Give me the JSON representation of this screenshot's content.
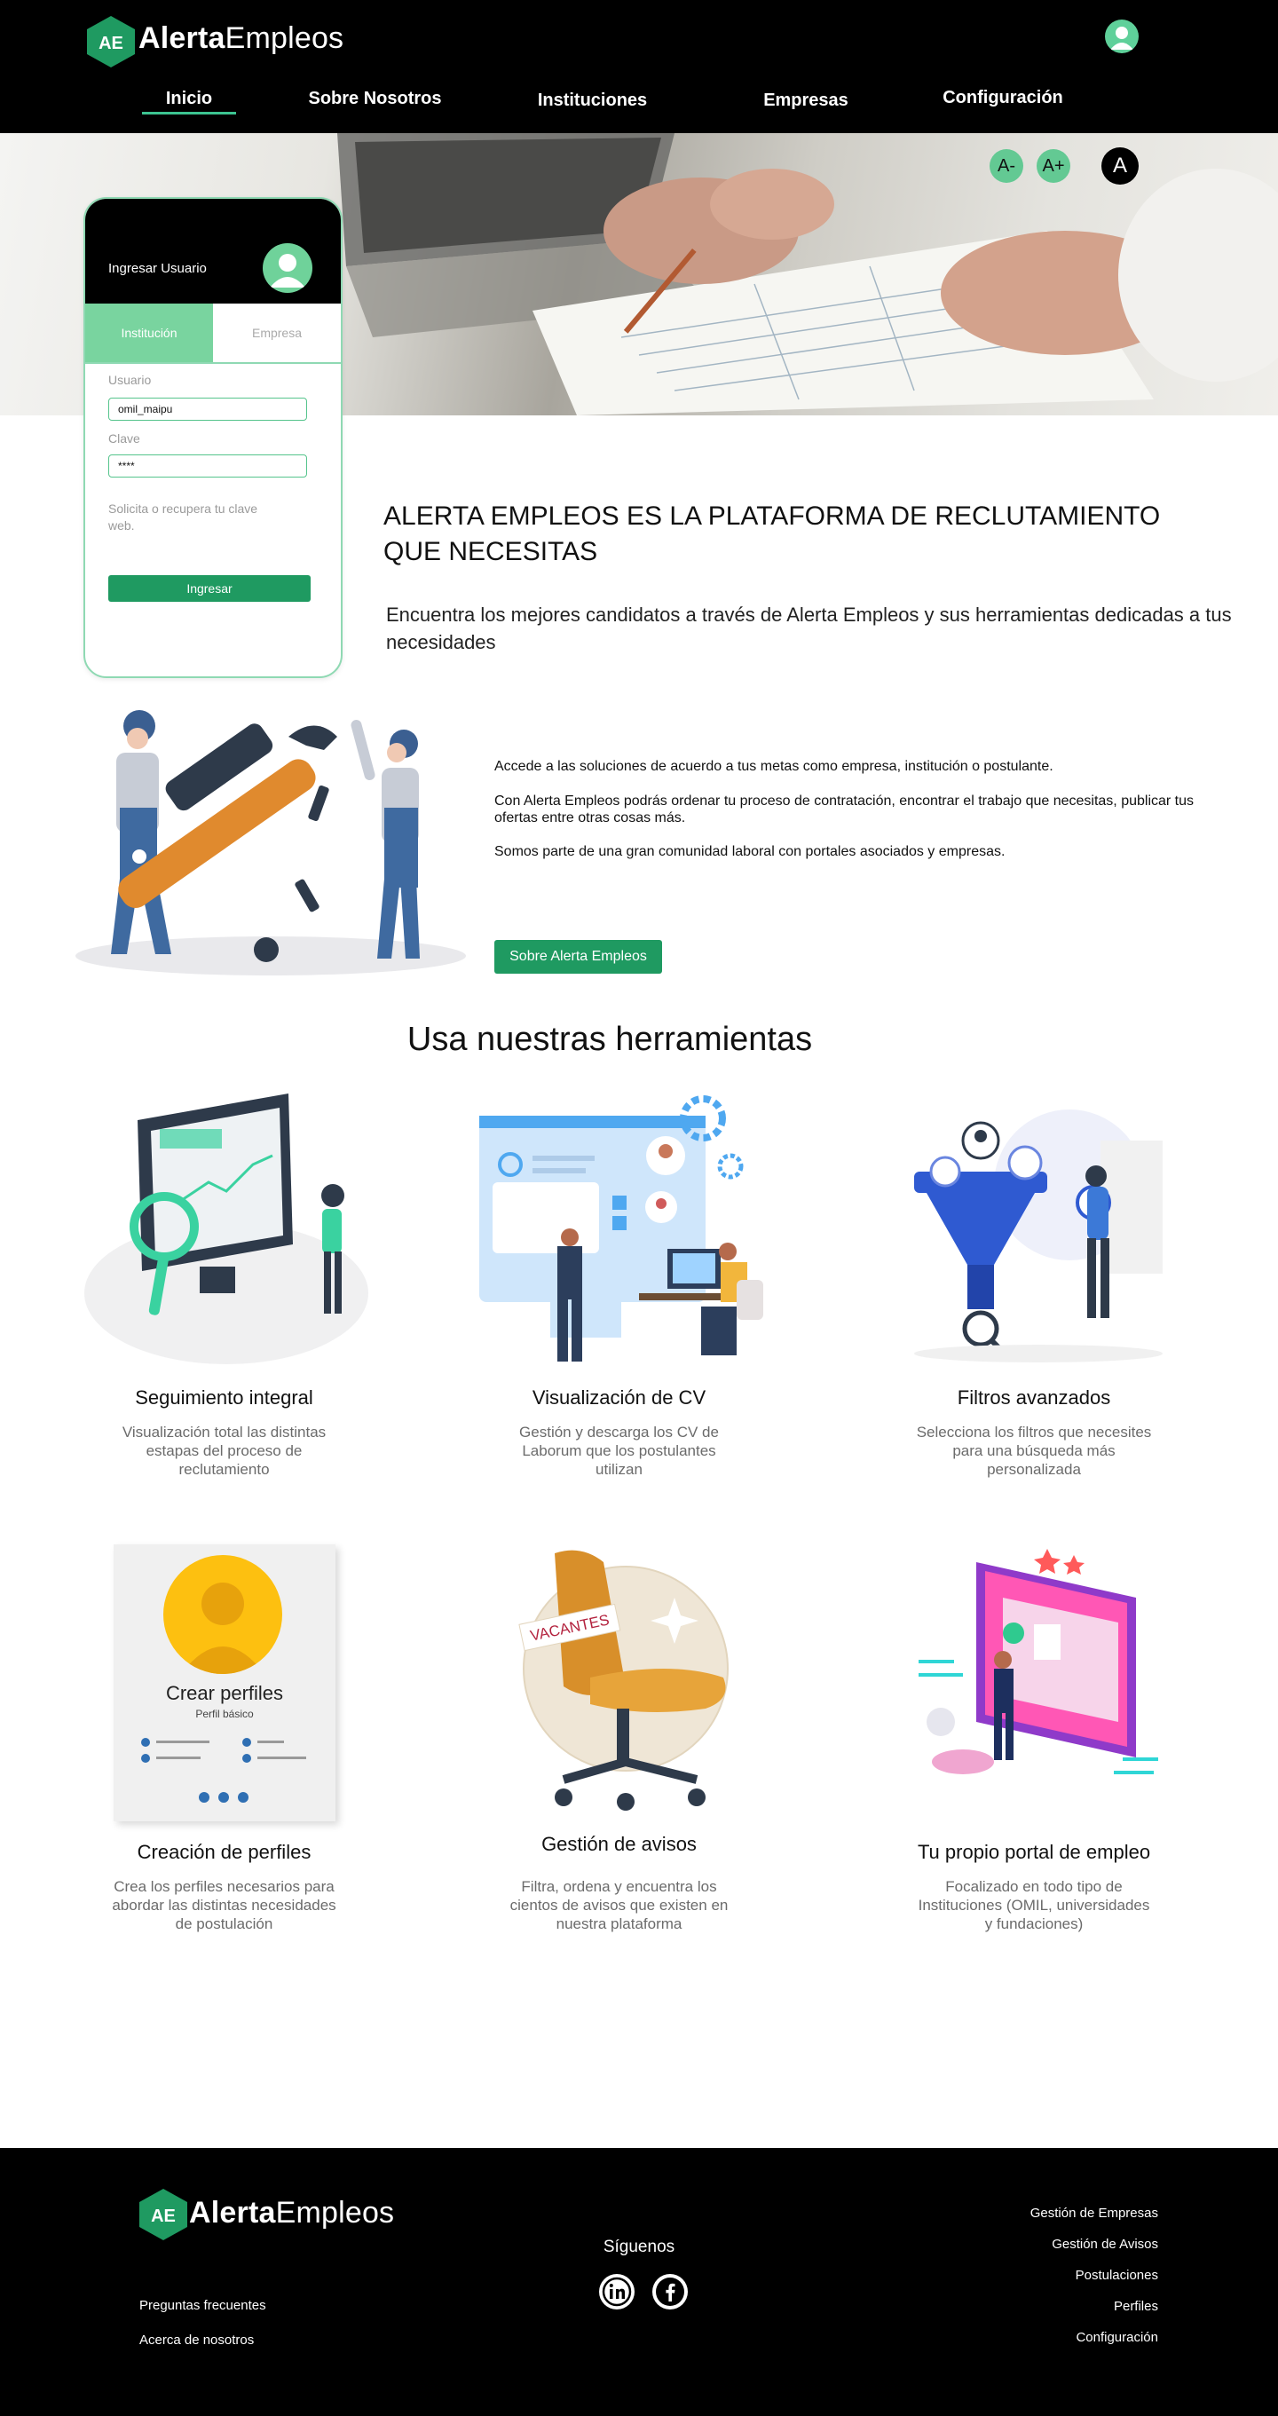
{
  "header": {
    "logo": {
      "bold": "Alerta",
      "regular": "Empleos",
      "mark": "AE"
    },
    "nav": [
      "Inicio",
      "Sobre Nosotros",
      "Instituciones",
      "Empresas",
      "Configuración"
    ],
    "active_nav": "Inicio"
  },
  "hero": {
    "font_controls": [
      "A-",
      "A+",
      "A"
    ]
  },
  "login": {
    "title": "Ingresar Usuario",
    "tabs": [
      "Institución",
      "Empresa"
    ],
    "user_label": "Usuario",
    "user_value": "omil_maipu",
    "password_label": "Clave",
    "password_value": "****",
    "recover_text": "Solicita o recupera tu clave web.",
    "submit_label": "Ingresar"
  },
  "intro": {
    "headline": "ALERTA EMPLEOS ES LA PLATAFORMA DE RECLUTAMIENTO QUE NECESITAS",
    "subhead": "Encuentra los mejores candidatos a través de Alerta Empleos y sus herramientas dedicadas a tus necesidades"
  },
  "about": {
    "paragraphs": [
      "Accede a las soluciones de acuerdo a tus metas como empresa, institución o postulante.",
      "Con Alerta Empleos podrás ordenar tu proceso de contratación, encontrar el trabajo  que necesitas, publicar tus ofertas entre otras cosas más.",
      "Somos parte de una gran comunidad laboral con portales asociados y empresas."
    ],
    "button_label": "Sobre Alerta Empleos"
  },
  "tools": {
    "title": "Usa nuestras herramientas",
    "items": [
      {
        "title": "Seguimiento integral",
        "desc": "Visualización total las distintas estapas del proceso de reclutamiento"
      },
      {
        "title": "Visualización de CV",
        "desc": "Gestión y descarga los CV de Laborum que los postulantes utilizan"
      },
      {
        "title": "Filtros avanzados",
        "desc": "Selecciona los filtros que necesites para una búsqueda más personalizada"
      },
      {
        "title": "Creación de perfiles",
        "desc": "Crea los perfiles necesarios para abordar las distintas necesidades de postulación"
      },
      {
        "title": "Gestión de avisos",
        "desc": "Filtra, ordena y encuentra los cientos de avisos que existen en nuestra plataforma"
      },
      {
        "title": "Tu propio portal de empleo",
        "desc": "Focalizado en todo tipo de Instituciones (OMIL, universidades y fundaciones)"
      }
    ],
    "profile_card": {
      "title": "Crear perfiles",
      "subtitle": "Perfil básico"
    },
    "vacantes_sign": "VACANTES"
  },
  "footer": {
    "left_links": [
      "Preguntas frecuentes",
      "Acerca de nosotros"
    ],
    "follow": "Síguenos",
    "right_links": [
      "Gestión de Empresas",
      "Gestión de Avisos",
      "Postulaciones",
      "Perfiles",
      "Configuración"
    ]
  },
  "colors": {
    "brand_green": "#1f9a61",
    "accent_green": "#79d49f",
    "header_bg": "#000000"
  }
}
